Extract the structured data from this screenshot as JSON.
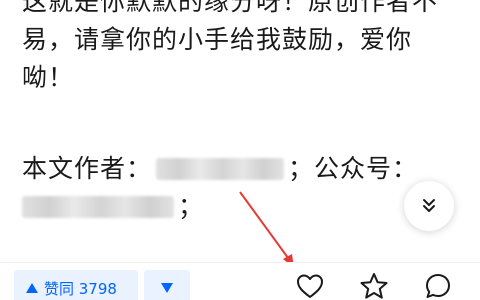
{
  "article": {
    "line1": "这就是你默默的缘分呀！原创作者不",
    "line2": "易，请拿你的小手给我鼓励，爱你",
    "line3": "呦！",
    "author_label": "本文作者：",
    "author_sep": "；公众号：",
    "account_end": "；"
  },
  "bottom_bar": {
    "vote_up_label": "赞同 3798"
  },
  "colors": {
    "accent": "#0066ff",
    "vote_bg": "#eaf2ff",
    "annotation_arrow": "#e53935"
  }
}
